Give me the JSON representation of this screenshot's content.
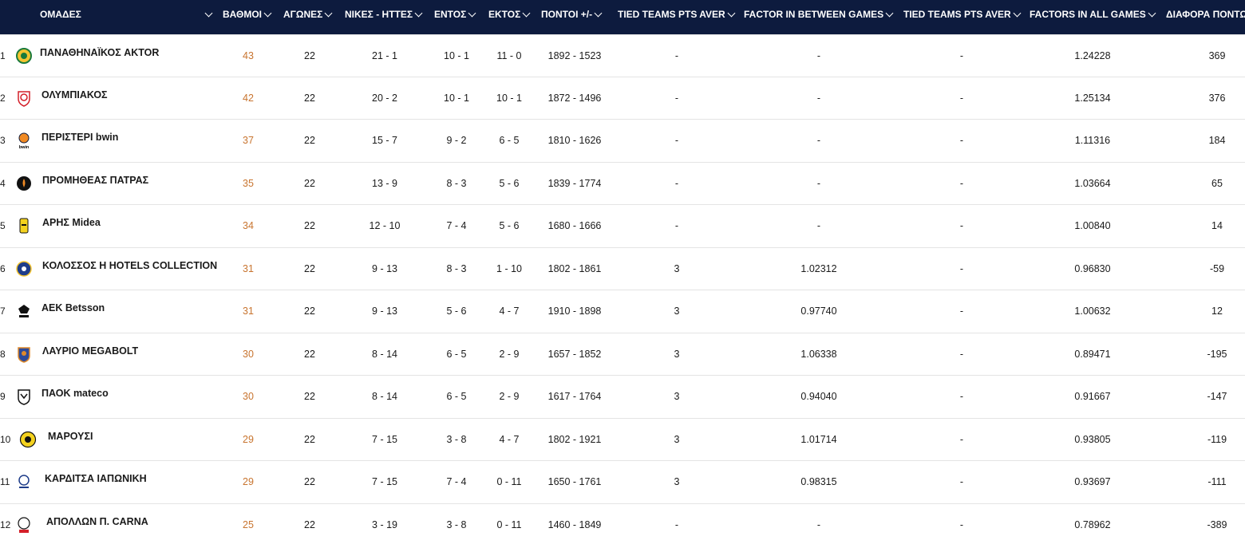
{
  "colors": {
    "header_bg": "#0d1b3e",
    "header_text": "#ffffff",
    "points_text": "#c8742f",
    "row_border": "#e4e4e4"
  },
  "headers": {
    "team": "ΟΜΑΔΕΣ",
    "points": "ΒΑΘΜΟΙ",
    "games": "ΑΓΩΝΕΣ",
    "wl": "ΝΙΚΕΣ - ΗΤΤΕΣ",
    "home": "ΕΝΤΟΣ",
    "away": "ΕΚΤΟΣ",
    "scores": "ΠΟΝΤΟΙ +/-",
    "tied1": "TIED TEAMS PTS AVER",
    "factor_between": "FACTOR IN BETWEEN GAMES",
    "tied2": "TIED TEAMS PTS AVER",
    "factor_all": "FACTORS IN ALL GAMES",
    "diff": "ΔΙΑΦΟΡΑ ΠΟΝΤΩΝ"
  },
  "rows": [
    {
      "pos": "1",
      "team": "ΠΑΝΑΘΗΝΑΪΚΟΣ AKTOR",
      "logo": "panathinaikos-logo",
      "points": "43",
      "games": "22",
      "wl": "21 - 1",
      "home": "10 - 1",
      "away": "11 - 0",
      "scores": "1892 - 1523",
      "tied1": "-",
      "factor_between": "-",
      "tied2": "-",
      "factor_all": "1.24228",
      "diff": "369"
    },
    {
      "pos": "2",
      "team": "ΟΛΥΜΠΙΑΚΟΣ",
      "logo": "olympiacos-logo",
      "points": "42",
      "games": "22",
      "wl": "20 - 2",
      "home": "10 - 1",
      "away": "10 - 1",
      "scores": "1872 - 1496",
      "tied1": "-",
      "factor_between": "-",
      "tied2": "-",
      "factor_all": "1.25134",
      "diff": "376"
    },
    {
      "pos": "3",
      "team": "ΠΕΡΙΣΤΕΡΙ bwin",
      "logo": "peristeri-logo",
      "logo_text": "bwin",
      "points": "37",
      "games": "22",
      "wl": "15 - 7",
      "home": "9 - 2",
      "away": "6 - 5",
      "scores": "1810 - 1626",
      "tied1": "-",
      "factor_between": "-",
      "tied2": "-",
      "factor_all": "1.11316",
      "diff": "184"
    },
    {
      "pos": "4",
      "team": "ΠΡΟΜΗΘΕΑΣ ΠΑΤΡΑΣ",
      "logo": "promitheas-logo",
      "points": "35",
      "games": "22",
      "wl": "13 - 9",
      "home": "8 - 3",
      "away": "5 - 6",
      "scores": "1839 - 1774",
      "tied1": "-",
      "factor_between": "-",
      "tied2": "-",
      "factor_all": "1.03664",
      "diff": "65"
    },
    {
      "pos": "5",
      "team": "ΑΡΗΣ Midea",
      "logo": "aris-logo",
      "points": "34",
      "games": "22",
      "wl": "12 - 10",
      "home": "7 - 4",
      "away": "5 - 6",
      "scores": "1680 - 1666",
      "tied1": "-",
      "factor_between": "-",
      "tied2": "-",
      "factor_all": "1.00840",
      "diff": "14"
    },
    {
      "pos": "6",
      "team": "ΚΟΛΟΣΣΟΣ H HOTELS COLLECTION",
      "logo": "kolossos-logo",
      "points": "31",
      "games": "22",
      "wl": "9 - 13",
      "home": "8 - 3",
      "away": "1 - 10",
      "scores": "1802 - 1861",
      "tied1": "3",
      "factor_between": "1.02312",
      "tied2": "-",
      "factor_all": "0.96830",
      "diff": "-59"
    },
    {
      "pos": "7",
      "team": "ΑΕΚ Betsson",
      "logo": "aek-logo",
      "points": "31",
      "games": "22",
      "wl": "9 - 13",
      "home": "5 - 6",
      "away": "4 - 7",
      "scores": "1910 - 1898",
      "tied1": "3",
      "factor_between": "0.97740",
      "tied2": "-",
      "factor_all": "1.00632",
      "diff": "12"
    },
    {
      "pos": "8",
      "team": "ΛΑΥΡΙΟ MEGABOLT",
      "logo": "lavrio-logo",
      "points": "30",
      "games": "22",
      "wl": "8 - 14",
      "home": "6 - 5",
      "away": "2 - 9",
      "scores": "1657 - 1852",
      "tied1": "3",
      "factor_between": "1.06338",
      "tied2": "-",
      "factor_all": "0.89471",
      "diff": "-195"
    },
    {
      "pos": "9",
      "team": "ΠΑΟΚ mateco",
      "logo": "paok-logo",
      "points": "30",
      "games": "22",
      "wl": "8 - 14",
      "home": "6 - 5",
      "away": "2 - 9",
      "scores": "1617 - 1764",
      "tied1": "3",
      "factor_between": "0.94040",
      "tied2": "-",
      "factor_all": "0.91667",
      "diff": "-147"
    },
    {
      "pos": "10",
      "team": "ΜΑΡΟΥΣΙ",
      "logo": "maroussi-logo",
      "points": "29",
      "games": "22",
      "wl": "7 - 15",
      "home": "3 - 8",
      "away": "4 - 7",
      "scores": "1802 - 1921",
      "tied1": "3",
      "factor_between": "1.01714",
      "tied2": "-",
      "factor_all": "0.93805",
      "diff": "-119"
    },
    {
      "pos": "11",
      "team": "ΚΑΡΔΙΤΣΑ ΙΑΠΩΝΙΚΗ",
      "logo": "karditsa-logo",
      "points": "29",
      "games": "22",
      "wl": "7 - 15",
      "home": "7 - 4",
      "away": "0 - 11",
      "scores": "1650 - 1761",
      "tied1": "3",
      "factor_between": "0.98315",
      "tied2": "-",
      "factor_all": "0.93697",
      "diff": "-111"
    },
    {
      "pos": "12",
      "team": "ΑΠΟΛΛΩΝ Π. CARNA",
      "logo": "apollon-logo",
      "points": "25",
      "games": "22",
      "wl": "3 - 19",
      "home": "3 - 8",
      "away": "0 - 11",
      "scores": "1460 - 1849",
      "tied1": "-",
      "factor_between": "-",
      "tied2": "-",
      "factor_all": "0.78962",
      "diff": "-389"
    }
  ]
}
